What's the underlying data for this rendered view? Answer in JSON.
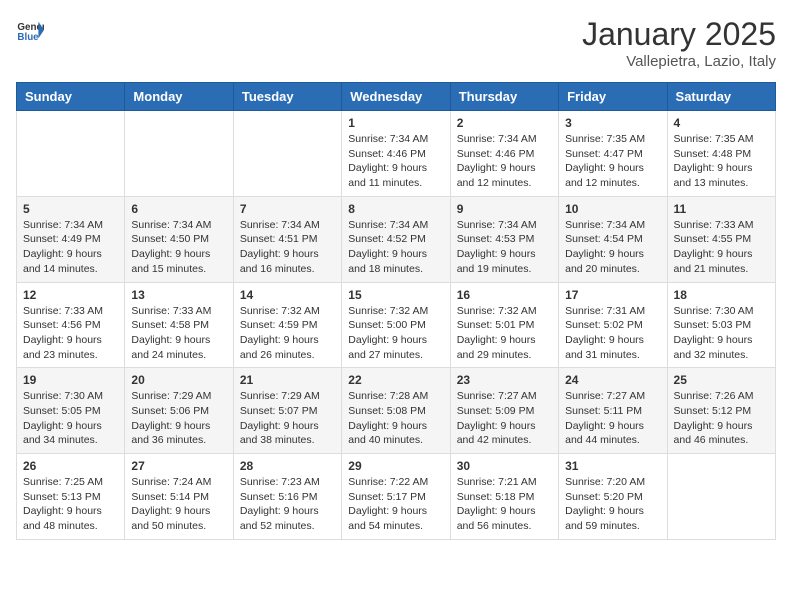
{
  "header": {
    "logo_general": "General",
    "logo_blue": "Blue",
    "month": "January 2025",
    "location": "Vallepietra, Lazio, Italy"
  },
  "weekdays": [
    "Sunday",
    "Monday",
    "Tuesday",
    "Wednesday",
    "Thursday",
    "Friday",
    "Saturday"
  ],
  "weeks": [
    [
      {
        "day": "",
        "info": ""
      },
      {
        "day": "",
        "info": ""
      },
      {
        "day": "",
        "info": ""
      },
      {
        "day": "1",
        "info": "Sunrise: 7:34 AM\nSunset: 4:46 PM\nDaylight: 9 hours\nand 11 minutes."
      },
      {
        "day": "2",
        "info": "Sunrise: 7:34 AM\nSunset: 4:46 PM\nDaylight: 9 hours\nand 12 minutes."
      },
      {
        "day": "3",
        "info": "Sunrise: 7:35 AM\nSunset: 4:47 PM\nDaylight: 9 hours\nand 12 minutes."
      },
      {
        "day": "4",
        "info": "Sunrise: 7:35 AM\nSunset: 4:48 PM\nDaylight: 9 hours\nand 13 minutes."
      }
    ],
    [
      {
        "day": "5",
        "info": "Sunrise: 7:34 AM\nSunset: 4:49 PM\nDaylight: 9 hours\nand 14 minutes."
      },
      {
        "day": "6",
        "info": "Sunrise: 7:34 AM\nSunset: 4:50 PM\nDaylight: 9 hours\nand 15 minutes."
      },
      {
        "day": "7",
        "info": "Sunrise: 7:34 AM\nSunset: 4:51 PM\nDaylight: 9 hours\nand 16 minutes."
      },
      {
        "day": "8",
        "info": "Sunrise: 7:34 AM\nSunset: 4:52 PM\nDaylight: 9 hours\nand 18 minutes."
      },
      {
        "day": "9",
        "info": "Sunrise: 7:34 AM\nSunset: 4:53 PM\nDaylight: 9 hours\nand 19 minutes."
      },
      {
        "day": "10",
        "info": "Sunrise: 7:34 AM\nSunset: 4:54 PM\nDaylight: 9 hours\nand 20 minutes."
      },
      {
        "day": "11",
        "info": "Sunrise: 7:33 AM\nSunset: 4:55 PM\nDaylight: 9 hours\nand 21 minutes."
      }
    ],
    [
      {
        "day": "12",
        "info": "Sunrise: 7:33 AM\nSunset: 4:56 PM\nDaylight: 9 hours\nand 23 minutes."
      },
      {
        "day": "13",
        "info": "Sunrise: 7:33 AM\nSunset: 4:58 PM\nDaylight: 9 hours\nand 24 minutes."
      },
      {
        "day": "14",
        "info": "Sunrise: 7:32 AM\nSunset: 4:59 PM\nDaylight: 9 hours\nand 26 minutes."
      },
      {
        "day": "15",
        "info": "Sunrise: 7:32 AM\nSunset: 5:00 PM\nDaylight: 9 hours\nand 27 minutes."
      },
      {
        "day": "16",
        "info": "Sunrise: 7:32 AM\nSunset: 5:01 PM\nDaylight: 9 hours\nand 29 minutes."
      },
      {
        "day": "17",
        "info": "Sunrise: 7:31 AM\nSunset: 5:02 PM\nDaylight: 9 hours\nand 31 minutes."
      },
      {
        "day": "18",
        "info": "Sunrise: 7:30 AM\nSunset: 5:03 PM\nDaylight: 9 hours\nand 32 minutes."
      }
    ],
    [
      {
        "day": "19",
        "info": "Sunrise: 7:30 AM\nSunset: 5:05 PM\nDaylight: 9 hours\nand 34 minutes."
      },
      {
        "day": "20",
        "info": "Sunrise: 7:29 AM\nSunset: 5:06 PM\nDaylight: 9 hours\nand 36 minutes."
      },
      {
        "day": "21",
        "info": "Sunrise: 7:29 AM\nSunset: 5:07 PM\nDaylight: 9 hours\nand 38 minutes."
      },
      {
        "day": "22",
        "info": "Sunrise: 7:28 AM\nSunset: 5:08 PM\nDaylight: 9 hours\nand 40 minutes."
      },
      {
        "day": "23",
        "info": "Sunrise: 7:27 AM\nSunset: 5:09 PM\nDaylight: 9 hours\nand 42 minutes."
      },
      {
        "day": "24",
        "info": "Sunrise: 7:27 AM\nSunset: 5:11 PM\nDaylight: 9 hours\nand 44 minutes."
      },
      {
        "day": "25",
        "info": "Sunrise: 7:26 AM\nSunset: 5:12 PM\nDaylight: 9 hours\nand 46 minutes."
      }
    ],
    [
      {
        "day": "26",
        "info": "Sunrise: 7:25 AM\nSunset: 5:13 PM\nDaylight: 9 hours\nand 48 minutes."
      },
      {
        "day": "27",
        "info": "Sunrise: 7:24 AM\nSunset: 5:14 PM\nDaylight: 9 hours\nand 50 minutes."
      },
      {
        "day": "28",
        "info": "Sunrise: 7:23 AM\nSunset: 5:16 PM\nDaylight: 9 hours\nand 52 minutes."
      },
      {
        "day": "29",
        "info": "Sunrise: 7:22 AM\nSunset: 5:17 PM\nDaylight: 9 hours\nand 54 minutes."
      },
      {
        "day": "30",
        "info": "Sunrise: 7:21 AM\nSunset: 5:18 PM\nDaylight: 9 hours\nand 56 minutes."
      },
      {
        "day": "31",
        "info": "Sunrise: 7:20 AM\nSunset: 5:20 PM\nDaylight: 9 hours\nand 59 minutes."
      },
      {
        "day": "",
        "info": ""
      }
    ]
  ]
}
